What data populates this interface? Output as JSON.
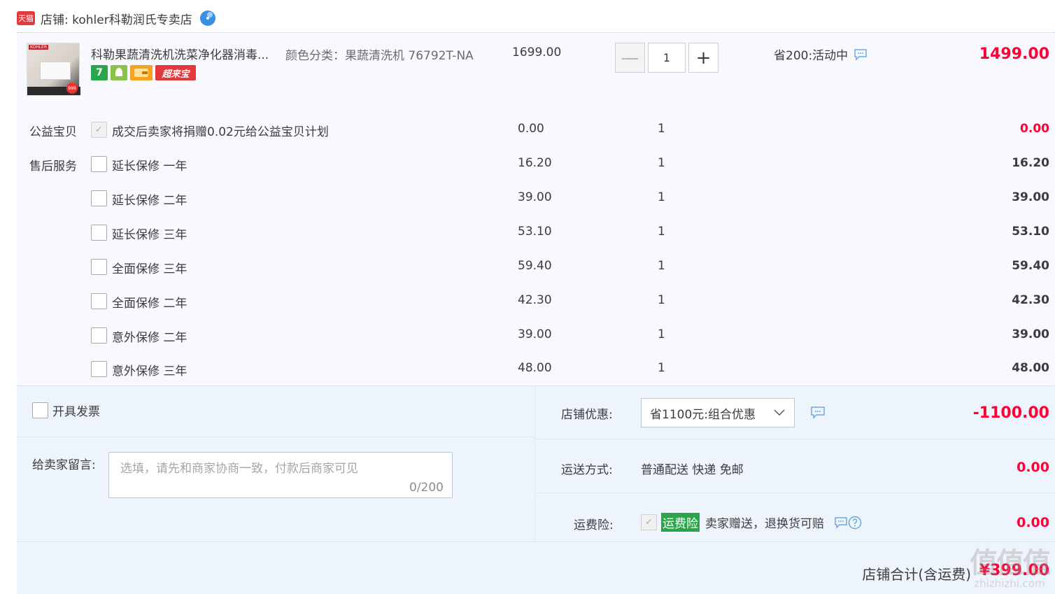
{
  "shop": {
    "logo_text": "天猫",
    "name": "店铺: kohler科勒润氏专卖店"
  },
  "product": {
    "thumb_brand": "KOHLER",
    "thumb_badge": "999",
    "title": "科勒果蔬清洗机洗菜净化器消毒...",
    "icons": [
      "7",
      "android-icon",
      "card-icon",
      "超来宝"
    ],
    "sku": "颜色分类：果蔬清洗机 76792T-NA",
    "unit_price": "1699.00",
    "quantity": "1",
    "minus_label": "—",
    "plus_label": "+",
    "promo": "省200:活动中",
    "total": "1499.00"
  },
  "services": [
    {
      "label": "公益宝贝",
      "text": "成交后卖家将捐赠0.02元给公益宝贝计划",
      "price": "0.00",
      "qty": "1",
      "total": "0.00",
      "checked": true
    },
    {
      "label": "售后服务",
      "text": "延长保修 一年",
      "price": "16.20",
      "qty": "1",
      "total": "16.20",
      "checked": false
    },
    {
      "label": "",
      "text": "延长保修 二年",
      "price": "39.00",
      "qty": "1",
      "total": "39.00",
      "checked": false
    },
    {
      "label": "",
      "text": "延长保修 三年",
      "price": "53.10",
      "qty": "1",
      "total": "53.10",
      "checked": false
    },
    {
      "label": "",
      "text": "全面保修 三年",
      "price": "59.40",
      "qty": "1",
      "total": "59.40",
      "checked": false
    },
    {
      "label": "",
      "text": "全面保修 二年",
      "price": "42.30",
      "qty": "1",
      "total": "42.30",
      "checked": false
    },
    {
      "label": "",
      "text": "意外保修 二年",
      "price": "39.00",
      "qty": "1",
      "total": "39.00",
      "checked": false
    },
    {
      "label": "",
      "text": "意外保修 三年",
      "price": "48.00",
      "qty": "1",
      "total": "48.00",
      "checked": false
    }
  ],
  "invoice": {
    "label": "开具发票"
  },
  "memo": {
    "label": "给卖家留言:",
    "placeholder": "选填，请先和商家协商一致，付款后商家可见",
    "count": "0/200"
  },
  "discount": {
    "label": "店铺优惠:",
    "selected": "省1100元:组合优惠",
    "amount": "-1100.00"
  },
  "shipping": {
    "label": "运送方式:",
    "value": "普通配送 快递 免邮",
    "amount": "0.00"
  },
  "insurance": {
    "label": "运费险:",
    "tag": "运费险",
    "text": "卖家赠送，退换货可赔",
    "amount": "0.00"
  },
  "summary": {
    "label": "店铺合计(含运费)",
    "amount": "¥399.00"
  },
  "watermark": {
    "big": "值值值",
    "small": "zhizhizhi.com"
  },
  "colors": {
    "price_red": "#ff0036",
    "tmall_red": "#e4393c",
    "green": "#2aa64a",
    "panel_bg": "#f7f9fe"
  }
}
